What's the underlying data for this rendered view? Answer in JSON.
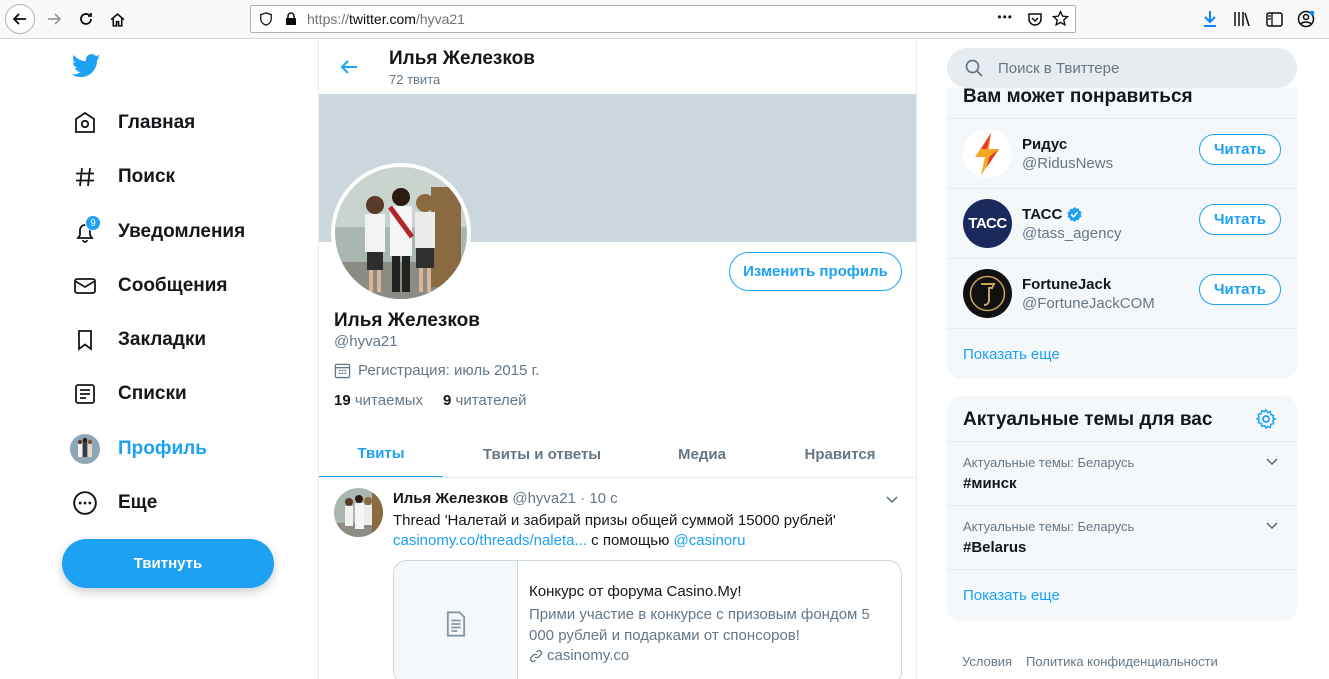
{
  "browser": {
    "url_prefix": "https://",
    "url_host": "twitter.com",
    "url_path": "/hyva21",
    "menu_dots": "•••"
  },
  "sidebar": {
    "items": [
      {
        "label": "Главная",
        "icon": "home-icon"
      },
      {
        "label": "Поиск",
        "icon": "hashtag-icon"
      },
      {
        "label": "Уведомления",
        "icon": "bell-icon",
        "badge": "9"
      },
      {
        "label": "Сообщения",
        "icon": "envelope-icon"
      },
      {
        "label": "Закладки",
        "icon": "bookmark-icon"
      },
      {
        "label": "Списки",
        "icon": "list-icon"
      },
      {
        "label": "Профиль",
        "icon": "avatar"
      },
      {
        "label": "Еще",
        "icon": "more-icon"
      }
    ],
    "tweet_button": "Твитнуть"
  },
  "header": {
    "name": "Илья Железков",
    "tweet_count": "72 твита"
  },
  "profile": {
    "name": "Илья Железков",
    "handle": "@hyva21",
    "joined": "Регистрация: июль 2015 г.",
    "following_count": "19",
    "following_label": "читаемых",
    "followers_count": "9",
    "followers_label": "читателей",
    "edit_button": "Изменить профиль"
  },
  "tabs": [
    {
      "label": "Твиты",
      "active": true
    },
    {
      "label": "Твиты и ответы",
      "active": false
    },
    {
      "label": "Медиа",
      "active": false
    },
    {
      "label": "Нравится",
      "active": false
    }
  ],
  "tweet": {
    "name": "Илья Железков",
    "handle": "@hyva21",
    "separator": "·",
    "time": "10 с",
    "text": "Thread 'Налетай и забирай призы общей суммой 15000 рублей'",
    "link": "casinomy.co/threads/naleta...",
    "via_text": "с помощью",
    "mention": "@casinoru",
    "card": {
      "title": "Конкурс от форума Casino.My!",
      "description": "Прими участие в конкурсе с призовым фондом 5 000 рублей и подарками от спонсоров!",
      "domain": "casinomy.co"
    }
  },
  "search": {
    "placeholder": "Поиск в Твиттере"
  },
  "who_to_follow": {
    "title": "Вам может понравиться",
    "accounts": [
      {
        "name": "Ридус",
        "handle": "@RidusNews",
        "verified": false,
        "button": "Читать"
      },
      {
        "name": "ТАСС",
        "handle": "@tass_agency",
        "verified": true,
        "button": "Читать",
        "logo_text": "ТАСС"
      },
      {
        "name": "FortuneJack",
        "handle": "@FortuneJackCOM",
        "verified": false,
        "button": "Читать"
      }
    ],
    "show_more": "Показать еще"
  },
  "trends": {
    "title": "Актуальные темы для вас",
    "items": [
      {
        "context": "Актуальные темы: Беларусь",
        "name": "#минск"
      },
      {
        "context": "Актуальные темы: Беларусь",
        "name": "#Belarus"
      }
    ],
    "show_more": "Показать еще"
  },
  "footer": {
    "terms": "Условия",
    "privacy": "Политика конфиденциальности"
  },
  "colors": {
    "accent": "#1da1f2",
    "banner": "#ccd6dd",
    "text_muted": "#657786"
  }
}
